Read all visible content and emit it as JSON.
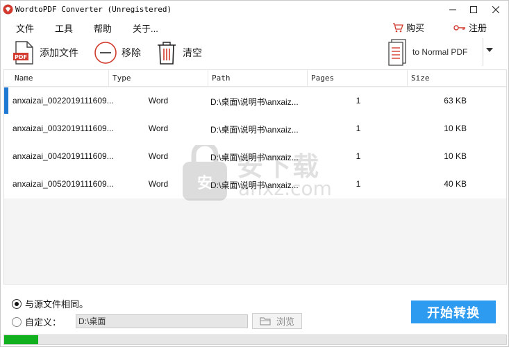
{
  "window": {
    "title": "WordtoPDF Converter (Unregistered)"
  },
  "menu": {
    "items": [
      "文件",
      "工具",
      "帮助",
      "关于..."
    ],
    "buy_label": "购买",
    "register_label": "注册"
  },
  "toolbar": {
    "add_label": "添加文件",
    "remove_label": "移除",
    "clear_label": "清空",
    "convert_mode_label": "to Normal PDF"
  },
  "table": {
    "columns": [
      "Name",
      "Type",
      "Path",
      "Pages",
      "Size"
    ],
    "rows": [
      {
        "name": "anxaizai_0022019111609...",
        "type": "Word",
        "path": "D:\\桌面\\说明书\\anxaiz...",
        "pages": "1",
        "size": "63 KB"
      },
      {
        "name": "anxaizai_0032019111609...",
        "type": "Word",
        "path": "D:\\桌面\\说明书\\anxaiz...",
        "pages": "1",
        "size": "10 KB"
      },
      {
        "name": "anxaizai_0042019111609...",
        "type": "Word",
        "path": "D:\\桌面\\说明书\\anxaiz...",
        "pages": "1",
        "size": "10 KB"
      },
      {
        "name": "anxaizai_0052019111609...",
        "type": "Word",
        "path": "D:\\桌面\\说明书\\anxaiz...",
        "pages": "1",
        "size": "40 KB"
      }
    ],
    "selected_row": 0
  },
  "watermark": {
    "title": "安下载",
    "subtitle": "anxz.com"
  },
  "output": {
    "same_as_source_label": "与源文件相同。",
    "custom_label": "自定义：",
    "custom_path": "D:\\桌面",
    "browse_label": "浏览",
    "selected": "same_as_source"
  },
  "actions": {
    "start_label": "开始转换"
  },
  "progress": {
    "fraction": 0.068
  },
  "colors": {
    "accent": "#2d9bf0",
    "selection": "#1f78d1",
    "progress": "#10b01e",
    "brand_red": "#d23a2e"
  }
}
